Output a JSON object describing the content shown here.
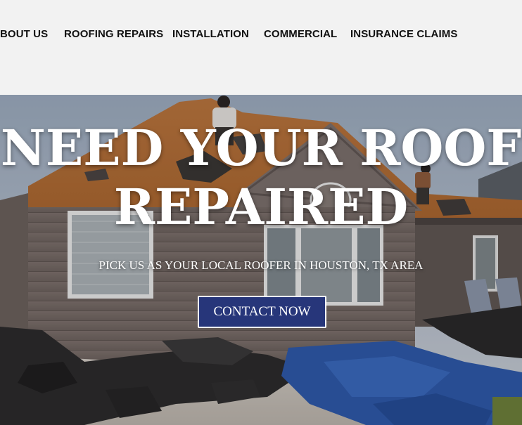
{
  "nav": {
    "items": [
      {
        "label": "BOUT US"
      },
      {
        "label": "ROOFING REPAIRS"
      },
      {
        "label": "INSTALLATION"
      },
      {
        "label": "COMMERCIAL"
      },
      {
        "label": "INSURANCE CLAIMS"
      }
    ]
  },
  "hero": {
    "title_line1": "NEED YOUR ROOF",
    "title_line2": "REPAIRED",
    "subtitle": "PICK US AS YOUR LOCAL ROOFER IN HOUSTON, TX AREA",
    "cta_label": "CONTACT NOW"
  },
  "colors": {
    "nav_bg": "#f2f2f2",
    "cta_bg": "#27367a",
    "text_light": "#ffffff"
  }
}
